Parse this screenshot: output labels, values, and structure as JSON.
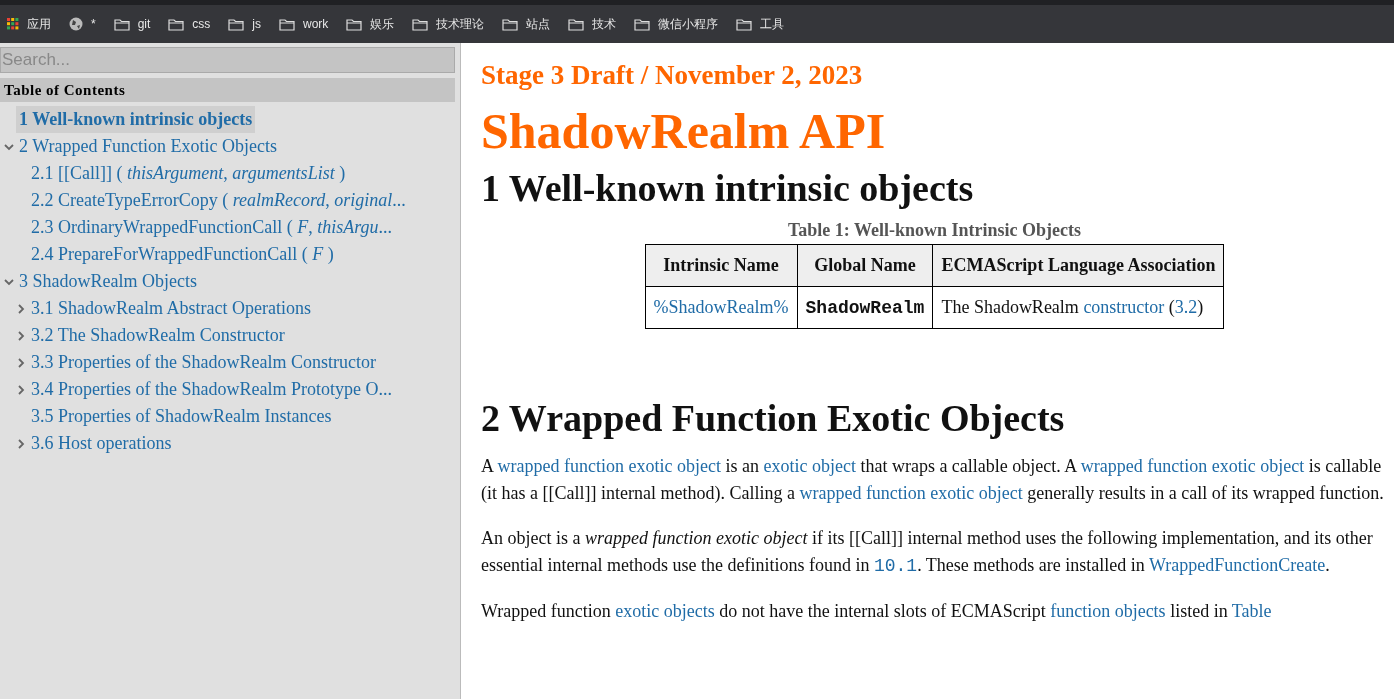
{
  "bookmarks_bar": {
    "items": [
      {
        "kind": "apps",
        "label": "应用"
      },
      {
        "kind": "globe",
        "label": "*"
      },
      {
        "kind": "folder",
        "label": "git"
      },
      {
        "kind": "folder",
        "label": "css"
      },
      {
        "kind": "folder",
        "label": "js"
      },
      {
        "kind": "folder",
        "label": "work"
      },
      {
        "kind": "folder",
        "label": "娱乐"
      },
      {
        "kind": "folder",
        "label": "技术理论"
      },
      {
        "kind": "folder",
        "label": "站点"
      },
      {
        "kind": "folder",
        "label": "技术"
      },
      {
        "kind": "folder",
        "label": "微信小程序"
      },
      {
        "kind": "folder",
        "label": "工具"
      }
    ]
  },
  "sidebar": {
    "search": {
      "placeholder": "Search..."
    },
    "heading": "Table of Contents",
    "items": [
      {
        "kind": "leaf",
        "label": "1 Well-known intrinsic objects",
        "selected": true
      },
      {
        "kind": "branch",
        "label": "2 Wrapped Function Exotic Objects",
        "selected": false,
        "expanded": true,
        "children": [
          {
            "kind": "leaf",
            "label": "2.1 [[Call]] ( *thisArgument*, *argumentsList* )",
            "selected": false
          },
          {
            "kind": "leaf",
            "label": "2.2 CreateTypeErrorCopy ( *realmRecord*, *original*...",
            "selected": false
          },
          {
            "kind": "leaf",
            "label": "2.3 OrdinaryWrappedFunctionCall ( *F*, *thisArgu*...",
            "selected": false
          },
          {
            "kind": "leaf",
            "label": "2.4 PrepareForWrappedFunctionCall ( *F* )",
            "selected": false
          }
        ]
      },
      {
        "kind": "branch",
        "label": "3 ShadowRealm Objects",
        "selected": false,
        "expanded": true,
        "children": [
          {
            "kind": "branch",
            "label": "3.1 ShadowRealm Abstract Operations",
            "selected": false,
            "expanded": false
          },
          {
            "kind": "branch",
            "label": "3.2 The ShadowRealm Constructor",
            "selected": false,
            "expanded": false
          },
          {
            "kind": "branch",
            "label": "3.3 Properties of the ShadowRealm Constructor",
            "selected": false,
            "expanded": false
          },
          {
            "kind": "branch",
            "label": "3.4 Properties of the ShadowRealm Prototype O...",
            "selected": false,
            "expanded": false
          },
          {
            "kind": "leaf",
            "label": "3.5 Properties of ShadowRealm Instances",
            "selected": false
          },
          {
            "kind": "branch",
            "label": "3.6 Host operations",
            "selected": false,
            "expanded": false
          }
        ]
      }
    ]
  },
  "document": {
    "status": "Stage 3 Draft / November 2, 2023",
    "title": "ShadowRealm API",
    "section_1": {
      "heading": "1 Well-known intrinsic objects",
      "table": {
        "caption": "Table 1: Well-known Intrinsic Objects",
        "columns": [
          "Intrinsic Name",
          "Global Name",
          "ECMAScript Language Association"
        ],
        "rows": [
          [
            [
              {
                "kind": "link",
                "text": "%ShadowRealm%"
              }
            ],
            [
              {
                "kind": "code",
                "text": "ShadowRealm"
              }
            ],
            [
              {
                "kind": "text",
                "text": "The ShadowRealm "
              },
              {
                "kind": "link",
                "text": "constructor"
              },
              {
                "kind": "text",
                "text": " ("
              },
              {
                "kind": "link",
                "text": "3.2"
              },
              {
                "kind": "text",
                "text": ")"
              }
            ]
          ]
        ]
      }
    },
    "section_2": {
      "heading": "2 Wrapped Function Exotic Objects",
      "paragraphs": [
        [
          {
            "kind": "text",
            "text": "A "
          },
          {
            "kind": "link",
            "text": "wrapped function exotic object"
          },
          {
            "kind": "text",
            "text": " is an "
          },
          {
            "kind": "link",
            "text": "exotic object"
          },
          {
            "kind": "text",
            "text": " that wraps a callable object. A "
          },
          {
            "kind": "link",
            "text": "wrapped function exotic object"
          },
          {
            "kind": "text",
            "text": " is callable (it has a [[Call]] internal method). Calling a "
          },
          {
            "kind": "link",
            "text": "wrapped function exotic object"
          },
          {
            "kind": "text",
            "text": " generally results in a call of its wrapped function."
          }
        ],
        [
          {
            "kind": "text",
            "text": "An object is a "
          },
          {
            "kind": "italic",
            "text": "wrapped function exotic object"
          },
          {
            "kind": "text",
            "text": " if its [[Call]] internal method uses the following implementation, and its other essential internal methods use the definitions found in "
          },
          {
            "kind": "link_code",
            "text": "10.1"
          },
          {
            "kind": "text",
            "text": ". These methods are installed in "
          },
          {
            "kind": "link",
            "text": "WrappedFunctionCreate"
          },
          {
            "kind": "text",
            "text": "."
          }
        ],
        [
          {
            "kind": "text",
            "text": "Wrapped function "
          },
          {
            "kind": "link",
            "text": "exotic objects"
          },
          {
            "kind": "text",
            "text": " do not have the internal slots of ECMAScript "
          },
          {
            "kind": "link",
            "text": "function objects"
          },
          {
            "kind": "text",
            "text": " listed in "
          },
          {
            "kind": "link",
            "text": "Table"
          }
        ]
      ]
    }
  }
}
